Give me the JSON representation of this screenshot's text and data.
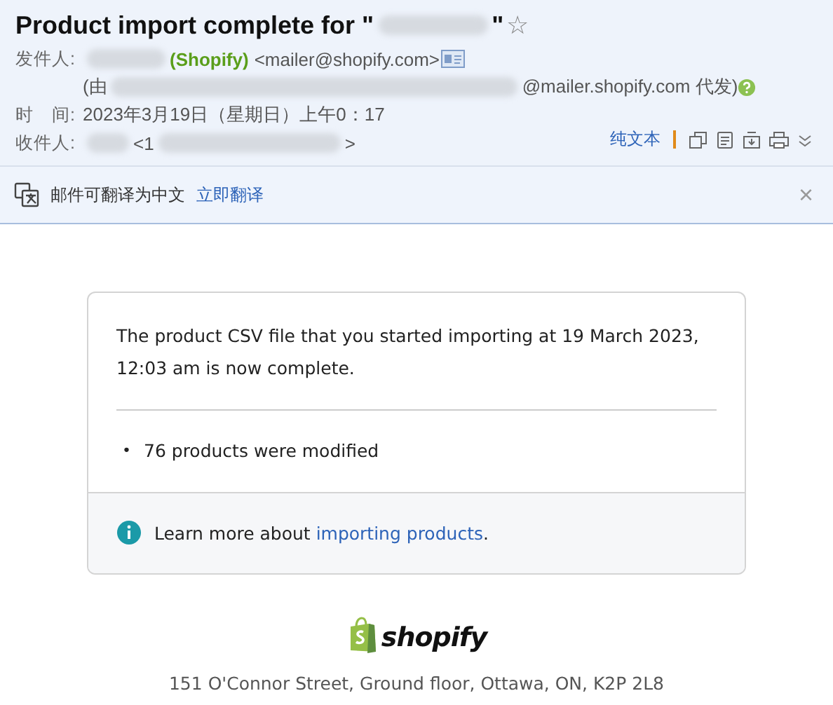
{
  "header": {
    "subject": {
      "before": "Product import complete for \"",
      "after": "\"",
      "star": "☆"
    },
    "sender": {
      "label": "发件人:",
      "name": "(Shopify)",
      "address": "<mailer@shopify.com>"
    },
    "on_behalf": {
      "open": "(由",
      "domain": "@mailer.shopify.com 代发)"
    },
    "time": {
      "label": "时　间:",
      "value": "2023年3月19日（星期日）上午0：17"
    },
    "recipient": {
      "label": "收件人:",
      "open": "<1",
      "close": ">"
    },
    "plain_text_link": "纯文本"
  },
  "translate_bar": {
    "message": "邮件可翻译为中文",
    "action": "立即翻译",
    "close": "×"
  },
  "card": {
    "intro": "The product CSV file that you started importing at 19 March 2023, 12:03 am is now complete.",
    "results": [
      {
        "bullet": "•",
        "text": "76 products were modified"
      }
    ],
    "learn_more": {
      "text": "Learn more about ",
      "link": "importing products",
      "end": "."
    }
  },
  "footer": {
    "brand": "shopify",
    "address": "151 O'Connor Street, Ground floor, Ottawa, ON, K2P 2L8"
  }
}
